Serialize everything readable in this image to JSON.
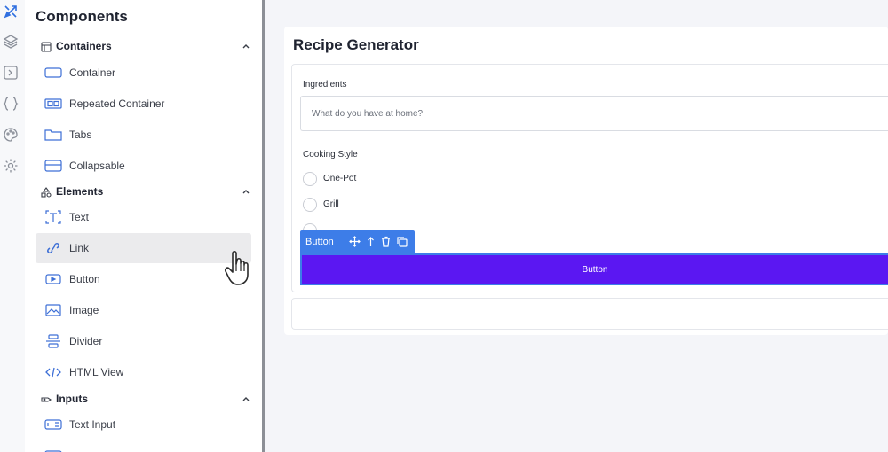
{
  "colors": {
    "accent": "#3d7de8",
    "button_bg": "#5b17f2",
    "brand_icon": "#2f6fe0"
  },
  "rail": {
    "icons": [
      "tools-icon",
      "layers-icon",
      "terminal-icon",
      "braces-icon",
      "palette-icon",
      "gear-icon"
    ]
  },
  "panel": {
    "title": "Components",
    "sections": [
      {
        "label": "Containers",
        "icon": "table-icon",
        "items": [
          "Container",
          "Repeated Container",
          "Tabs",
          "Collapsable"
        ]
      },
      {
        "label": "Elements",
        "icon": "shapes-icon",
        "items": [
          "Text",
          "Link",
          "Button",
          "Image",
          "Divider",
          "HTML View"
        ]
      },
      {
        "label": "Inputs",
        "icon": "tag-icon",
        "items": [
          "Text Input"
        ]
      }
    ]
  },
  "canvas": {
    "title": "Recipe Generator",
    "ingredients_label": "Ingredients",
    "ingredients_placeholder": "What do you have at home?",
    "cooking_style_label": "Cooking Style",
    "options": [
      "One-Pot",
      "Grill"
    ],
    "toolbar_label": "Button",
    "button_label": "Button"
  }
}
